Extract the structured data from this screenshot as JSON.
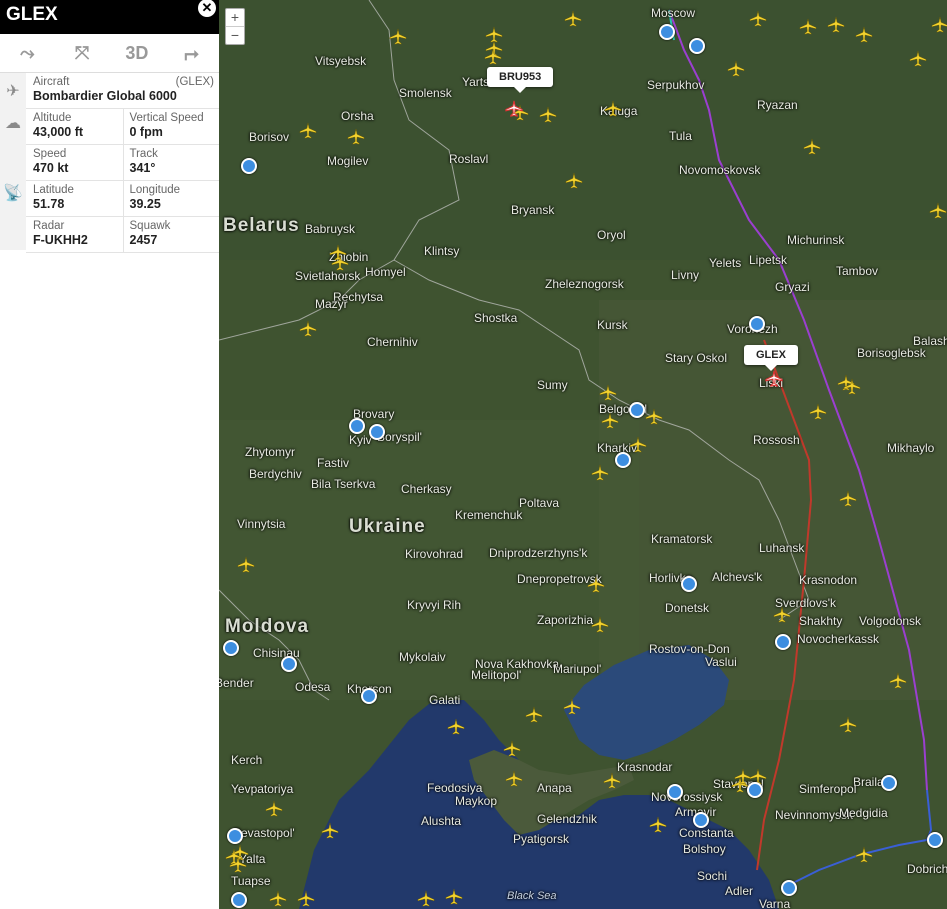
{
  "panel": {
    "title": "GLEX",
    "close_icon": "close-icon",
    "toolbar": [
      {
        "name": "route-button",
        "icon": "route-icon",
        "glyph": "⤳"
      },
      {
        "name": "fullscreen-button",
        "icon": "compress-icon",
        "glyph": "⦻"
      },
      {
        "name": "3d-button",
        "label": "3D"
      },
      {
        "name": "share-button",
        "icon": "share-icon",
        "glyph": "↪"
      }
    ],
    "aircraft_label": "Aircraft",
    "aircraft_code": "(GLEX)",
    "aircraft_value": "Bombardier Global 6000",
    "fields": [
      [
        {
          "key": "Altitude",
          "value": "43,000 ft"
        },
        {
          "key": "Vertical Speed",
          "value": "0 fpm"
        }
      ],
      [
        {
          "key": "Speed",
          "value": "470 kt"
        },
        {
          "key": "Track",
          "value": "341°"
        }
      ],
      [
        {
          "key": "Latitude",
          "value": "51.78"
        },
        {
          "key": "Longitude",
          "value": "39.25"
        }
      ],
      [
        {
          "key": "Radar",
          "value": "F-UKHH2"
        },
        {
          "key": "Squawk",
          "value": "2457"
        }
      ]
    ]
  },
  "map": {
    "zoom_in": "+",
    "zoom_out": "−",
    "callouts": [
      {
        "id": "callout-bru953",
        "text": "BRU953"
      },
      {
        "id": "callout-glex",
        "text": "GLEX"
      }
    ],
    "countries": [
      "Belarus",
      "Ukraine",
      "Moldova"
    ],
    "seas": [
      "Black Sea"
    ],
    "cities": [
      "Moscow",
      "Vitsyebsk",
      "Smolensk",
      "Yarts",
      "Serpukhov",
      "Kaluga",
      "Tula",
      "Ryazan",
      "Orsha",
      "Borisov",
      "Mogilev",
      "Roslavl",
      "Novomoskovsk",
      "Bryansk",
      "Babruysk",
      "Zhlobin",
      "Klintsy",
      "Oryol",
      "Michurinsk",
      "Yelets",
      "Lipetsk",
      "Tambov",
      "Svietlahorsk",
      "Homyel",
      "Rechytsa",
      "Zheleznogorsk",
      "Livny",
      "Gryazi",
      "Mazyr",
      "Shostka",
      "Kursk",
      "Voronezh",
      "Balasho",
      "Chernihiv",
      "Stary Oskol",
      "Borisoglebsk",
      "Sumy",
      "Liski",
      "Brovary",
      "Boryspil'",
      "Kyiv",
      "Belgorod",
      "Zhytomyr",
      "Fastiv",
      "Kharkiv",
      "Rossosh",
      "Mikhaylo",
      "Berdychiv",
      "Bila Tserkva",
      "Poltava",
      "Cherkasy",
      "Kremenchuk",
      "Vinnytsia",
      "Kirovohrad",
      "Dniprodzerzhyns'k",
      "Kramatorsk",
      "Luhansk",
      "Alchevs'k",
      "Krasnodon",
      "Dnepropetrovsk",
      "Horlivka",
      "Donetsk",
      "Sverdlovs'k",
      "Kryvyi Rih",
      "Zaporizhia",
      "Shakhty",
      "Volgodonsk",
      "Novocherkassk",
      "Chisinau",
      "Mykolaiv",
      "Nova Kakhovka",
      "Melitopol'",
      "Mariupol'",
      "Rostov-on-Don",
      "Vaslui",
      "Bender",
      "Odesa",
      "Kherson",
      "Galati",
      "Kerch",
      "Krasnodar",
      "Stavropol",
      "Braila",
      "Yevpatoriya",
      "Feodosiya",
      "Anapa",
      "Novorossiysk",
      "Armavir",
      "Simferopol",
      "Maykop",
      "Nevinnomyssk",
      "Medgidia",
      "Sevastopol'",
      "Alushta",
      "Gelendzhik",
      "Constanta",
      "Yalta",
      "Pyatigorsk",
      "Dobrich",
      "Tuapse",
      "Bolshoy",
      "Sochi",
      "Adler",
      "Varna"
    ],
    "flight_track_colors": {
      "planned": "#c0392b",
      "flown_high": "#9b3fd0",
      "flown_mid": "#3a5fd6",
      "flown_low": "#29c6b0"
    },
    "plane_color": "#f2d22e",
    "pin_color": "#3d8ee0"
  }
}
